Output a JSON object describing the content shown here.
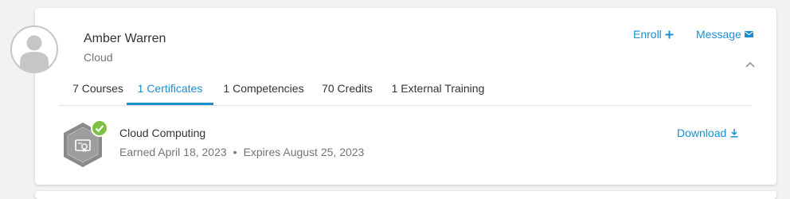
{
  "profile": {
    "name": "Amber Warren",
    "subtitle": "Cloud"
  },
  "header_actions": {
    "enroll_label": "Enroll",
    "message_label": "Message"
  },
  "tabs": [
    {
      "label": "7 Courses"
    },
    {
      "label": "1 Certificates",
      "active": true
    },
    {
      "label": "1 Competencies"
    },
    {
      "label": "70 Credits"
    },
    {
      "label": "1 External Training"
    }
  ],
  "certificate": {
    "title": "Cloud Computing",
    "earned": "Earned April 18, 2023",
    "separator": "•",
    "expires": "Expires August 25, 2023",
    "download_label": "Download"
  },
  "icons": {
    "avatar": "user-silhouette-icon",
    "enroll": "plus-icon",
    "message": "envelope-icon",
    "collapse": "chevron-up-icon",
    "badge": "certificate-hexagon-icon",
    "badge_status": "check-circle-icon",
    "download": "download-icon"
  },
  "colors": {
    "accent": "#1a8fcf",
    "success": "#7cc242",
    "badge": "#8a8a8a"
  }
}
